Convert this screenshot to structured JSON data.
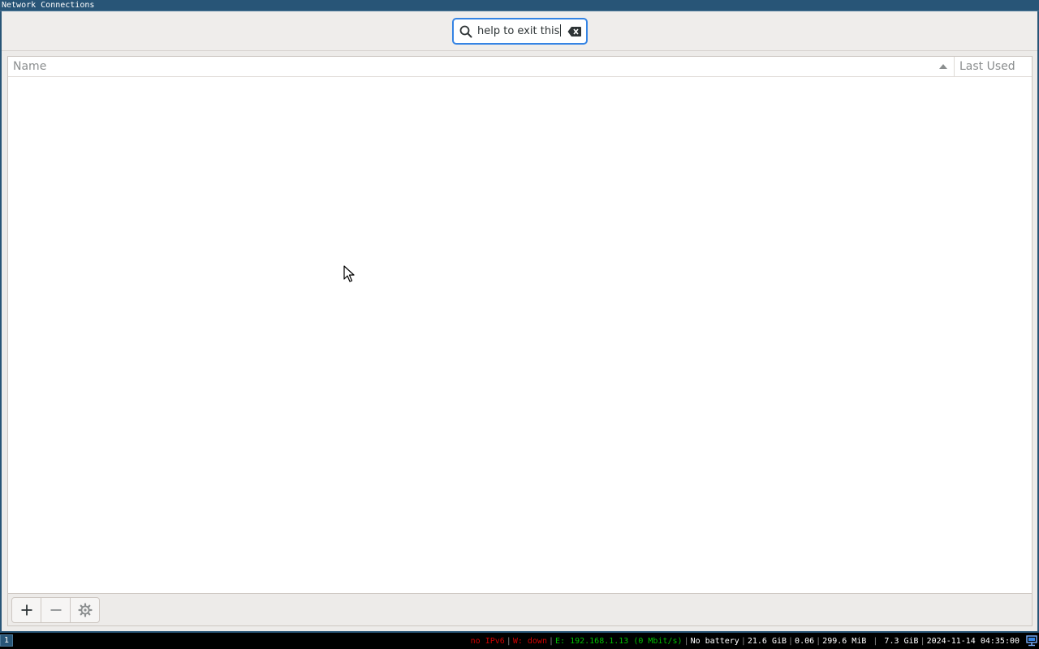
{
  "window": {
    "title": "Network Connections"
  },
  "search": {
    "value": "help to exit this",
    "icon": "search-icon",
    "clear_icon": "clear-text-icon"
  },
  "list": {
    "columns": [
      {
        "label": "Name",
        "sorted": "ascending"
      },
      {
        "label": "Last Used"
      }
    ],
    "rows": []
  },
  "toolbar": {
    "add": "add-connection-icon",
    "remove": "remove-connection-icon",
    "settings": "gear-icon"
  },
  "statusbar": {
    "workspace": "1",
    "items": [
      {
        "text": "no IPv6",
        "color": "#d40000"
      },
      {
        "text": "W: down",
        "color": "#d40000"
      },
      {
        "text": "E: 192.168.1.13 (0 Mbit/s)",
        "color": "#00c000"
      },
      {
        "text": "No battery",
        "color": "#ffffff"
      },
      {
        "text": "21.6 GiB",
        "color": "#ffffff"
      },
      {
        "text": "0.06",
        "color": "#ffffff"
      },
      {
        "text": "299.6 MiB",
        "color": "#ffffff"
      },
      {
        "text": "7.3 GiB",
        "color": "#ffffff"
      },
      {
        "text": "2024-11-14 04:35:00",
        "color": "#ffffff"
      }
    ]
  },
  "colors": {
    "accent": "#3584e4",
    "titlebar": "#285577"
  }
}
